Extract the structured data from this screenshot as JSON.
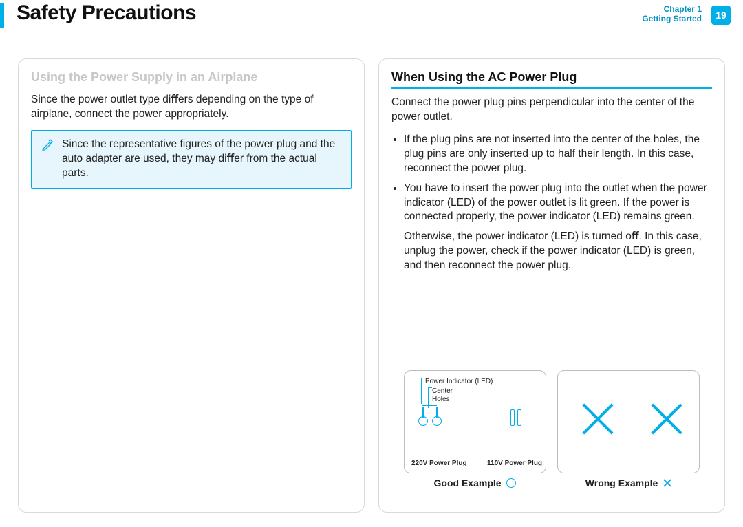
{
  "header": {
    "title": "Safety Precautions",
    "chapter_line1": "Chapter 1",
    "chapter_line2": "Getting Started",
    "page_number": "19"
  },
  "left": {
    "heading": "Using the Power Supply in an Airplane",
    "intro": "Since the power outlet type diﬀers depending on the type of airplane, connect the power appropriately.",
    "note": "Since the representative ﬁgures of the power plug and the auto adapter are used, they may diﬀer from the actual parts."
  },
  "right": {
    "heading": "When Using the AC Power Plug",
    "intro": "Connect the power plug pins perpendicular into the center of the power outlet.",
    "bullets": [
      "If the plug pins are not inserted into the center of the holes, the plug pins are only inserted up to half their length. In this case, reconnect the power plug.",
      "You have to insert the power plug into the outlet when the power indicator (LED) of the power outlet is lit green. If the power is connected properly, the power indicator (LED) remains green."
    ],
    "para_after": "Otherwise, the power indicator (LED) is turned oﬀ. In this case, unplug the power, check if the power indicator (LED) is green, and then reconnect the power plug.",
    "diagram_good": {
      "led_label": "Power Indicator (LED)",
      "center_label": "Center",
      "holes_label": "Holes",
      "plug220_label": "220V Power Plug",
      "plug110_label": "110V Power Plug",
      "caption": "Good Example"
    },
    "diagram_wrong": {
      "caption": "Wrong Example"
    }
  }
}
